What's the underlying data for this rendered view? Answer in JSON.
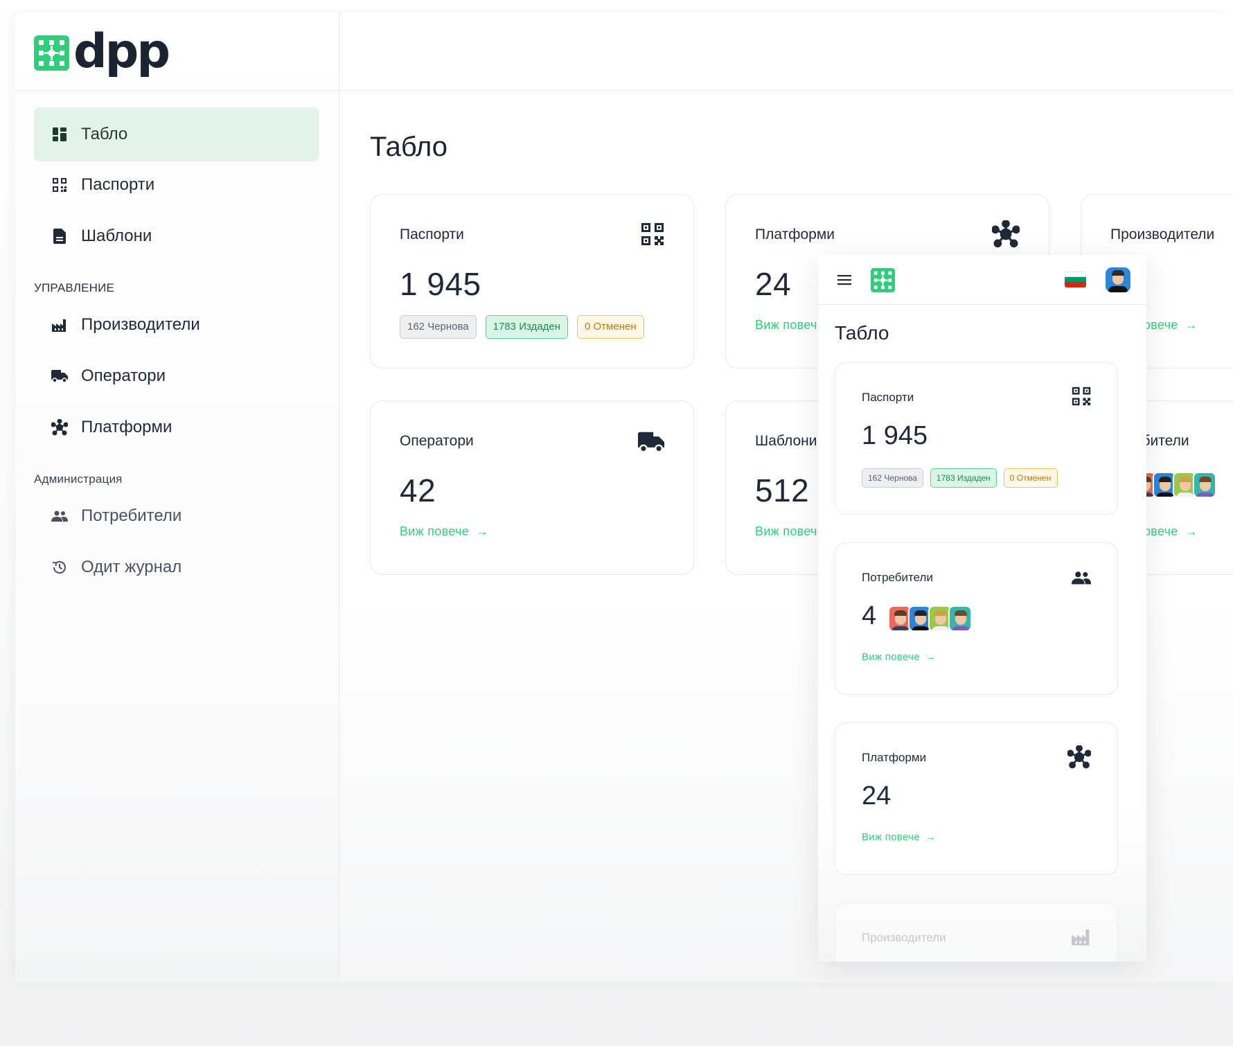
{
  "brand": {
    "name": "dpp",
    "accent": "#2dcf7b",
    "active_bg": "#e3f3ea"
  },
  "sidebar": {
    "items": [
      {
        "label": "Табло",
        "icon": "dashboard-icon",
        "active": true
      },
      {
        "label": "Паспорти",
        "icon": "qr-code-icon"
      },
      {
        "label": "Шаблони",
        "icon": "document-icon"
      }
    ],
    "section_manage": "УПРАВЛЕНИЕ",
    "manage_items": [
      {
        "label": "Производители",
        "icon": "factory-icon"
      },
      {
        "label": "Оператори",
        "icon": "truck-icon"
      },
      {
        "label": "Платформи",
        "icon": "hub-icon"
      }
    ],
    "section_admin": "Администрация",
    "admin_items": [
      {
        "label": "Потребители",
        "icon": "users-icon"
      },
      {
        "label": "Одит журнал",
        "icon": "history-icon"
      }
    ]
  },
  "main": {
    "title": "Табло",
    "see_more": "Виж повече",
    "cards": {
      "passports": {
        "label": "Паспорти",
        "value": "1 945",
        "icon": "qr-code-icon",
        "badges": {
          "draft": "162 Чернова",
          "issued": "1783 Издаден",
          "cancelled": "0 Отменен"
        }
      },
      "platforms": {
        "label": "Платформи",
        "value": "24",
        "icon": "hub-icon",
        "see_more_partial": "Виж повеч"
      },
      "producers": {
        "label": "Производители",
        "icon": "factory-icon",
        "see_more_partial": "овече"
      },
      "operators": {
        "label": "Оператори",
        "value": "42",
        "icon": "truck-icon"
      },
      "templates": {
        "label": "Шаблони",
        "value": "512",
        "see_more_partial": "Виж повеч"
      },
      "users": {
        "label_partial": "ебители",
        "see_more_partial": "овече"
      }
    }
  },
  "mobile": {
    "title": "Табло",
    "menu_icon": "hamburger-icon",
    "flag": "bulgaria-flag-icon",
    "see_more": "Виж повече",
    "cards": {
      "passports": {
        "label": "Паспорти",
        "value": "1 945",
        "badges": {
          "draft": "162 Чернова",
          "issued": "1783 Издаден",
          "cancelled": "0 Отменен"
        }
      },
      "users": {
        "label": "Потребители",
        "value": "4"
      },
      "platforms": {
        "label": "Платформи",
        "value": "24"
      },
      "producers": {
        "label": "Производители"
      }
    }
  }
}
